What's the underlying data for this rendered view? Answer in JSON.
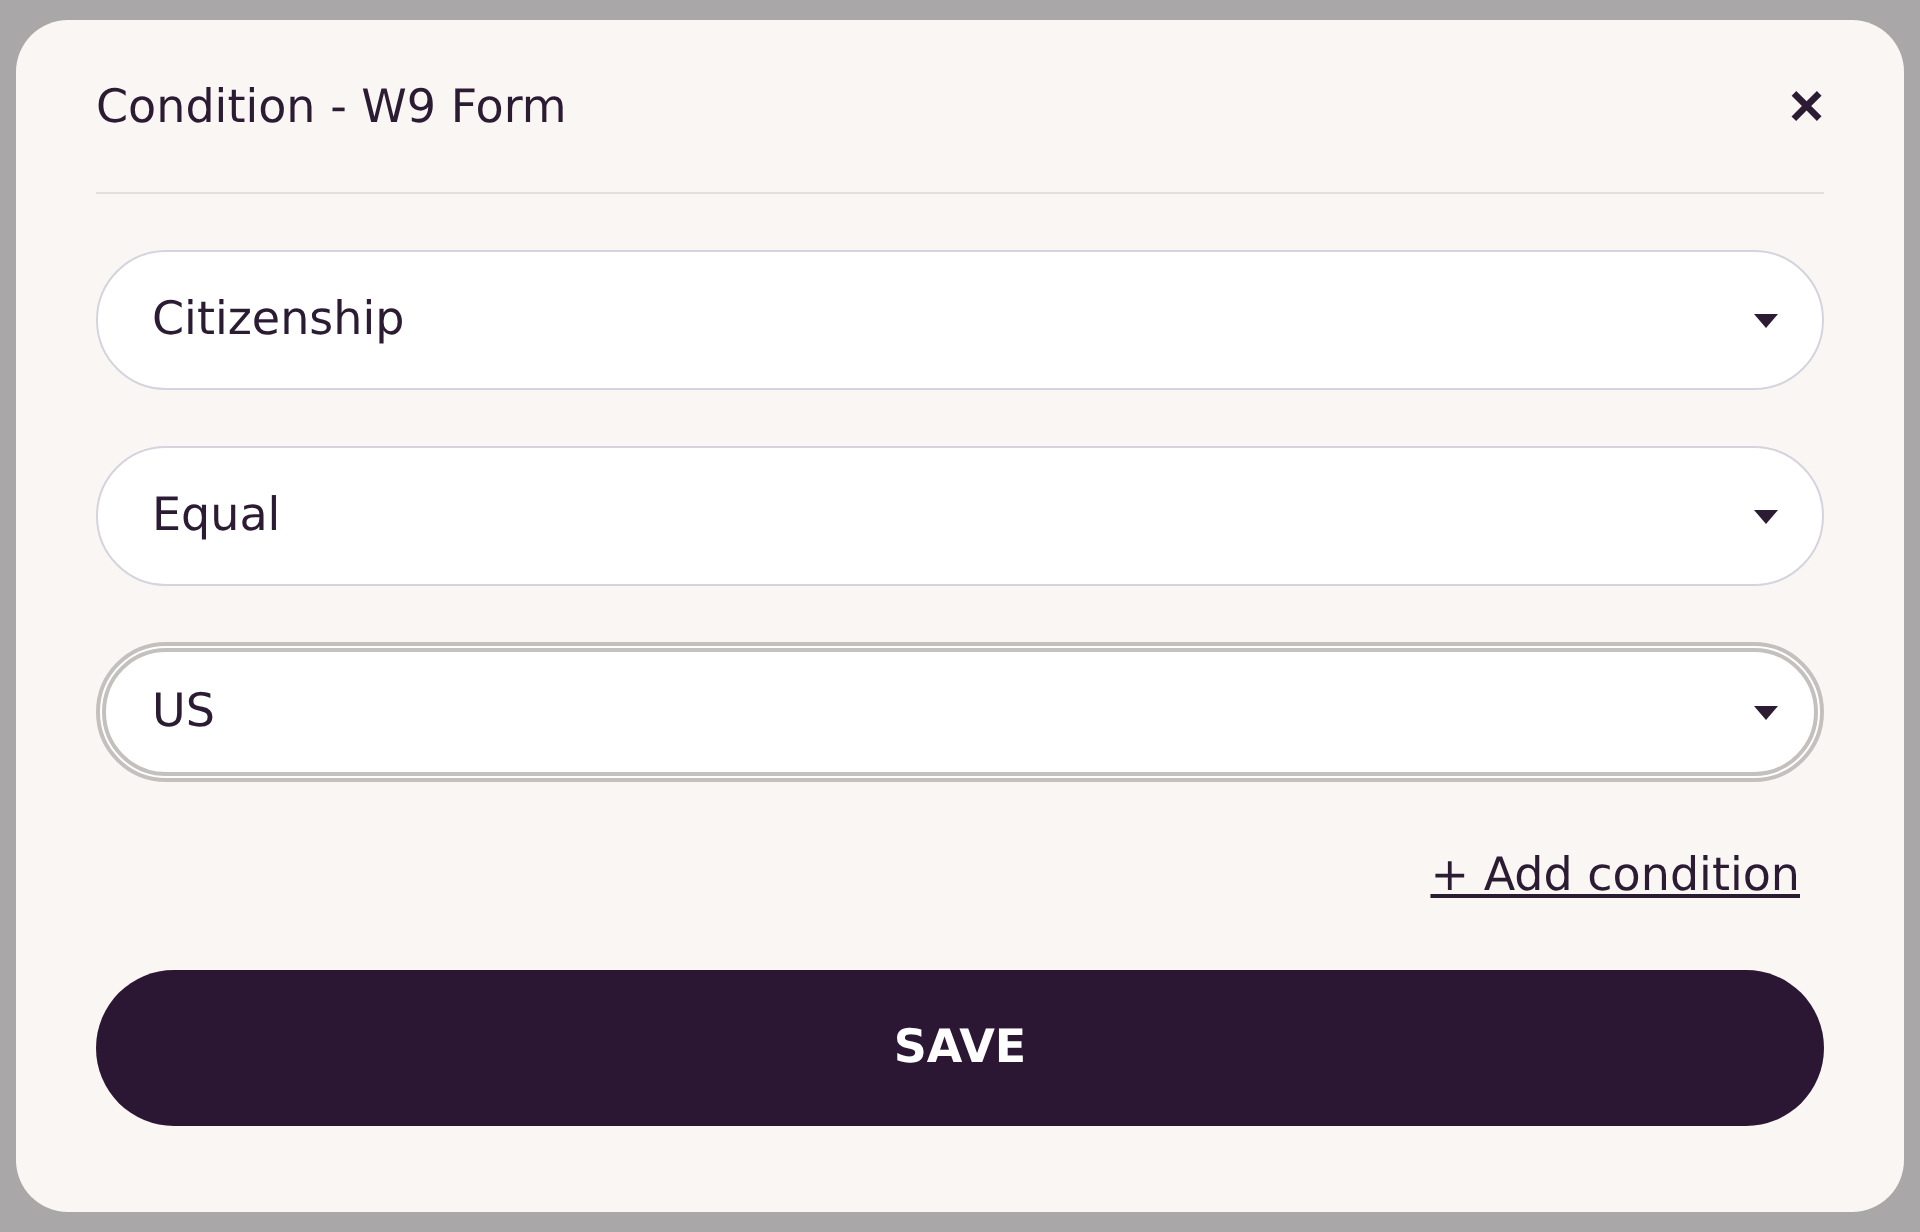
{
  "dialog": {
    "title": "Condition - W9 Form",
    "close_icon": "×"
  },
  "fields": [
    {
      "value": "Citizenship",
      "focused": false
    },
    {
      "value": "Equal",
      "focused": false
    },
    {
      "value": "US",
      "focused": true
    }
  ],
  "add_link": "+ Add condition",
  "save_button": "SAVE"
}
